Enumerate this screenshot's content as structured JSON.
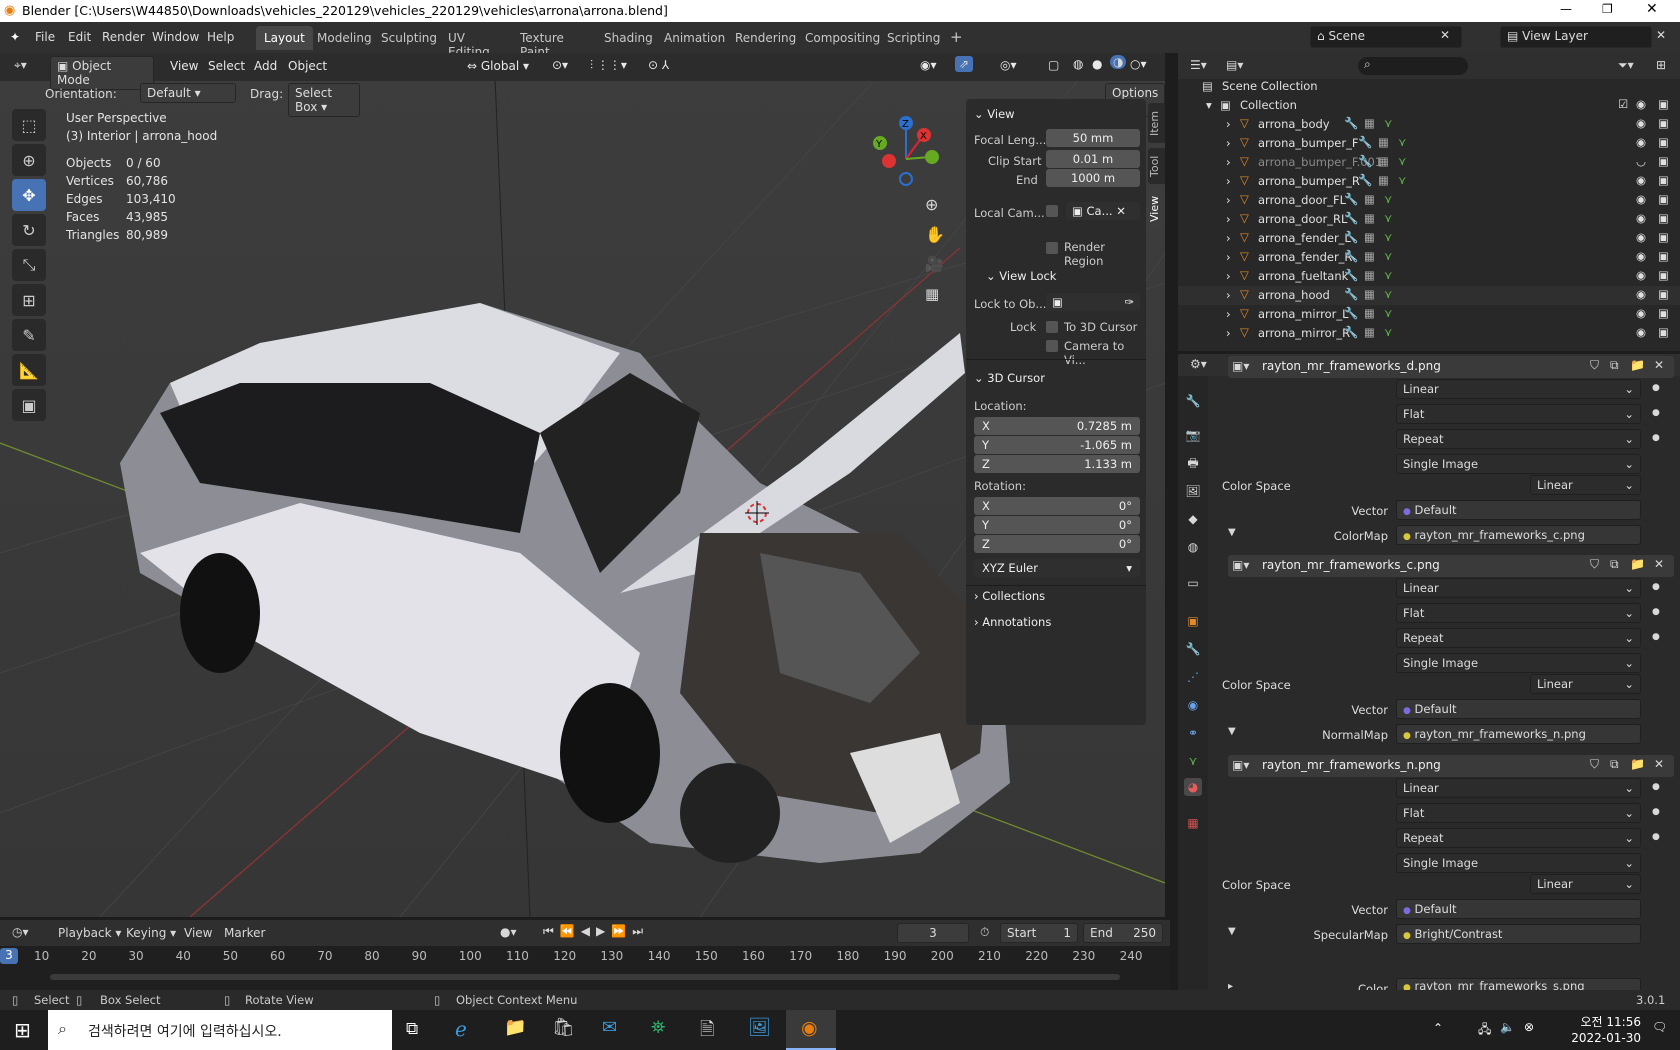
{
  "window": {
    "title": "Blender [C:\\Users\\W44850\\Downloads\\vehicles_220129\\vehicles_220129\\vehicles\\arrona\\arrona.blend]",
    "version": "3.0.1"
  },
  "menu": [
    "File",
    "Edit",
    "Render",
    "Window",
    "Help"
  ],
  "workspaces": [
    "Layout",
    "Modeling",
    "Sculpting",
    "UV Editing",
    "Texture Paint",
    "Shading",
    "Animation",
    "Rendering",
    "Compositing",
    "Scripting"
  ],
  "header": {
    "scene_label": "Scene",
    "view_layer_label": "View Layer"
  },
  "viewport": {
    "mode": "Object Mode",
    "menus": [
      "View",
      "Select",
      "Add",
      "Object"
    ],
    "transform": "Global",
    "orientation_label": "Orientation:",
    "orientation_value": "Default",
    "drag_label": "Drag:",
    "drag_value": "Select Box",
    "options": "Options",
    "perspective": "User Perspective",
    "active": "(3) Interior | arrona_hood",
    "stats": [
      [
        "Objects",
        "0 / 60"
      ],
      [
        "Vertices",
        "60,786"
      ],
      [
        "Edges",
        "103,410"
      ],
      [
        "Faces",
        "43,985"
      ],
      [
        "Triangles",
        "80,989"
      ]
    ]
  },
  "npanel": {
    "view_header": "View",
    "focal_label": "Focal Leng...",
    "focal": "50 mm",
    "clip_start_label": "Clip Start",
    "clip_start": "0.01 m",
    "clip_end_label": "End",
    "clip_end": "1000 m",
    "local_cam_label": "Local Cam...",
    "local_cam_value": "Ca...",
    "render_region": "Render Region",
    "view_lock": "View Lock",
    "lock_obj_label": "Lock to Ob...",
    "lock_label": "Lock",
    "to_cursor": "To 3D Cursor",
    "camera_to_view": "Camera to Vi...",
    "cursor_header": "3D Cursor",
    "location_label": "Location:",
    "loc": [
      [
        "X",
        "0.7285 m"
      ],
      [
        "Y",
        "-1.065 m"
      ],
      [
        "Z",
        "1.133 m"
      ]
    ],
    "rotation_label": "Rotation:",
    "rot": [
      [
        "X",
        "0°"
      ],
      [
        "Y",
        "0°"
      ],
      [
        "Z",
        "0°"
      ]
    ],
    "rotation_mode": "XYZ Euler",
    "collections": "Collections",
    "annotations": "Annotations",
    "tabs": [
      "Item",
      "Tool",
      "View"
    ]
  },
  "outliner": {
    "scene_collection": "Scene Collection",
    "collection": "Collection",
    "items": [
      "arrona_body",
      "arrona_bumper_F",
      "arrona_bumper_F.001",
      "arrona_bumper_R",
      "arrona_door_FL",
      "arrona_door_RL",
      "arrona_fender_L",
      "arrona_fender_R",
      "arrona_fueltank",
      "arrona_hood",
      "arrona_mirror_L",
      "arrona_mirror_R"
    ]
  },
  "properties": {
    "blocks": [
      {
        "image": "rayton_mr_frameworks_d.png",
        "interp": "Linear",
        "proj": "Flat",
        "ext": "Repeat",
        "src": "Single Image",
        "cs_label": "Color Space",
        "cs": "Linear",
        "vec_label": "Vector",
        "vec": "Default",
        "next_label": "ColorMap",
        "next": "rayton_mr_frameworks_c.png"
      },
      {
        "image": "rayton_mr_frameworks_c.png",
        "interp": "Linear",
        "proj": "Flat",
        "ext": "Repeat",
        "src": "Single Image",
        "cs_label": "Color Space",
        "cs": "Linear",
        "vec_label": "Vector",
        "vec": "Default",
        "next_label": "NormalMap",
        "next": "rayton_mr_frameworks_n.png"
      },
      {
        "image": "rayton_mr_frameworks_n.png",
        "interp": "Linear",
        "proj": "Flat",
        "ext": "Repeat",
        "src": "Single Image",
        "cs_label": "Color Space",
        "cs": "Linear",
        "vec_label": "Vector",
        "vec": "Default",
        "next_label": "SpecularMap",
        "next": "Bright/Contrast"
      }
    ],
    "last_label": "Color",
    "last_value": "rayton_mr_frameworks_s.png"
  },
  "timeline": {
    "menus": [
      "Playback",
      "Keying",
      "View",
      "Marker"
    ],
    "current": "3",
    "start_label": "Start",
    "start": "1",
    "end_label": "End",
    "end": "250",
    "ticks": [
      "10",
      "20",
      "30",
      "40",
      "50",
      "60",
      "70",
      "80",
      "90",
      "100",
      "110",
      "120",
      "130",
      "140",
      "150",
      "160",
      "170",
      "180",
      "190",
      "200",
      "210",
      "220",
      "230",
      "240"
    ]
  },
  "status": {
    "select": "Select",
    "box_select": "Box Select",
    "rotate": "Rotate View",
    "context": "Object Context Menu"
  },
  "taskbar": {
    "search_placeholder": "검색하려면 여기에 입력하십시오.",
    "time": "오전 11:56",
    "date": "2022-01-30"
  }
}
